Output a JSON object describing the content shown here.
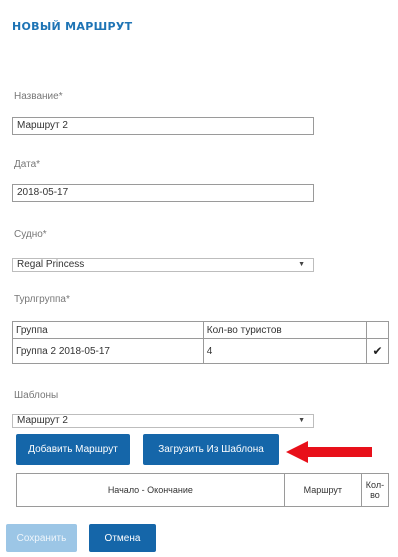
{
  "page_title": "НОВЫЙ МАРШРУТ",
  "form": {
    "name_label": "Название*",
    "name_value": "Маршрут 2",
    "date_label": "Дата*",
    "date_value": "2018-05-17",
    "ship_label": "Судно*",
    "ship_value": "Regal Princess",
    "tourgroup_label": "Турлгруппа*",
    "templates_label": "Шаблоны",
    "template_value": "Маршрут 2"
  },
  "tour_table": {
    "headers": [
      "Группа",
      "Кол-во туристов",
      ""
    ],
    "rows": [
      {
        "group": "Группа 2 2018-05-17",
        "count": "4",
        "checked": true
      }
    ]
  },
  "buttons": {
    "add_route": "Добавить Маршрут",
    "load_template": "Загрузить Из Шаблона",
    "save": "Сохранить",
    "cancel": "Отмена"
  },
  "route_table": {
    "headers": [
      "Начало - Окончание",
      "Маршрут",
      "Кол-во"
    ]
  },
  "colors": {
    "accent": "#1566a9",
    "title": "#1e74b5",
    "arrow": "#e8101a"
  },
  "icons": {
    "select_chevron": "chevron-down-icon",
    "row_checkbox": "checkbox-checked-icon",
    "pointer_arrow": "arrow-left-icon"
  }
}
